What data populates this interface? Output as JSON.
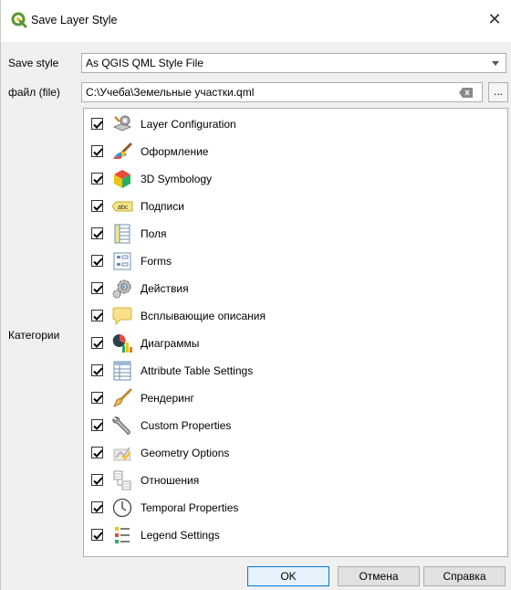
{
  "window": {
    "title": "Save Layer Style",
    "close_glyph": "✕"
  },
  "save_style": {
    "label": "Save style",
    "value": "As QGIS QML Style File"
  },
  "file": {
    "label": "файл (file)",
    "value": "C:\\Учеба\\Земельные участки.qml",
    "browse_label": "..."
  },
  "categories_label": "Категории",
  "categories": [
    {
      "label": "Layer Configuration",
      "checked": true,
      "icon": "layer-config-icon"
    },
    {
      "label": "Оформление",
      "checked": true,
      "icon": "paintbrush-icon"
    },
    {
      "label": "3D Symbology",
      "checked": true,
      "icon": "cube-3d-icon"
    },
    {
      "label": "Подписи",
      "checked": true,
      "icon": "abc-label-icon"
    },
    {
      "label": "Поля",
      "checked": true,
      "icon": "fields-icon"
    },
    {
      "label": "Forms",
      "checked": true,
      "icon": "forms-icon"
    },
    {
      "label": "Действия",
      "checked": true,
      "icon": "actions-gear-icon"
    },
    {
      "label": "Всплывающие описания",
      "checked": true,
      "icon": "speech-bubble-icon"
    },
    {
      "label": "Диаграммы",
      "checked": true,
      "icon": "diagrams-icon"
    },
    {
      "label": "Attribute Table Settings",
      "checked": true,
      "icon": "attribute-table-icon"
    },
    {
      "label": "Рендеринг",
      "checked": true,
      "icon": "rendering-brush-icon"
    },
    {
      "label": "Custom Properties",
      "checked": true,
      "icon": "wrench-icon"
    },
    {
      "label": "Geometry Options",
      "checked": true,
      "icon": "geometry-options-icon"
    },
    {
      "label": "Отношения",
      "checked": true,
      "icon": "relations-icon"
    },
    {
      "label": "Temporal Properties",
      "checked": true,
      "icon": "clock-icon"
    },
    {
      "label": "Legend Settings",
      "checked": true,
      "icon": "legend-icon"
    }
  ],
  "buttons": {
    "ok": "OK",
    "cancel": "Отмена",
    "help": "Справка"
  },
  "colors": {
    "qgis_green": "#589632",
    "ok_border": "#0078d7"
  }
}
